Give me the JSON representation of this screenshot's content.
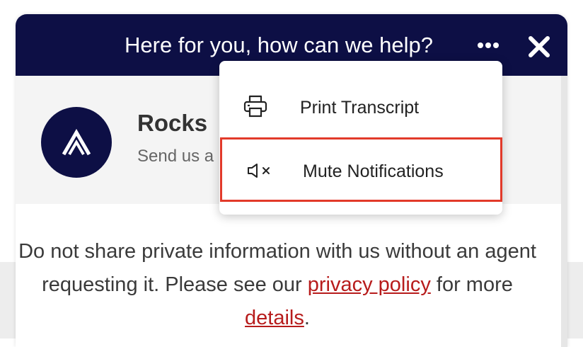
{
  "header": {
    "title": "Here for you, how can we help?",
    "more_icon": "more-horizontal-icon",
    "close_icon": "close-icon",
    "background_color": "#0d0f45"
  },
  "agent": {
    "name": "Rocks",
    "subtitle": "Send us a",
    "avatar_icon": "brand-logo-icon"
  },
  "menu": {
    "items": [
      {
        "label": "Print Transcript",
        "icon": "printer-icon"
      },
      {
        "label": "Mute Notifications",
        "icon": "speaker-mute-icon",
        "highlighted": true
      }
    ],
    "highlight_color": "#e23a2a"
  },
  "notice": {
    "text_before": "Do not share private information with us without an agent requesting it. Please see our ",
    "privacy_link": "privacy policy",
    "text_middle": " for more ",
    "details_link": "details",
    "text_after": ".",
    "link_color": "#b71c1c"
  }
}
